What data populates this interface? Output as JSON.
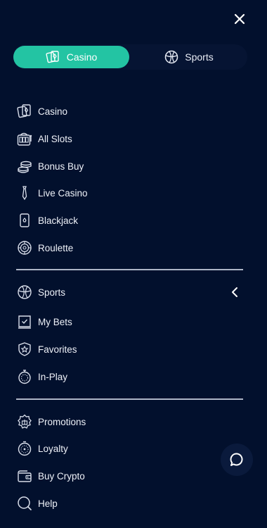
{
  "header": {
    "close_icon": "close-icon"
  },
  "toggle": {
    "casino_label": "Casino",
    "sports_label": "Sports",
    "active": "Casino",
    "accent_color": "#23c4a3"
  },
  "casino_section": {
    "items": [
      {
        "label": "Casino",
        "icon": "cards-icon"
      },
      {
        "label": "All Slots",
        "icon": "slot-machine-icon"
      },
      {
        "label": "Bonus Buy",
        "icon": "coins-icon"
      },
      {
        "label": "Live Casino",
        "icon": "tie-icon"
      },
      {
        "label": "Blackjack",
        "icon": "playing-card-icon"
      },
      {
        "label": "Roulette",
        "icon": "roulette-icon"
      }
    ]
  },
  "sports_section": {
    "items": [
      {
        "label": "Sports",
        "icon": "basketball-icon"
      },
      {
        "label": "My Bets",
        "icon": "bet-slip-icon"
      },
      {
        "label": "Favorites",
        "icon": "star-badge-icon"
      },
      {
        "label": "In-Play",
        "icon": "stopwatch-icon"
      }
    ]
  },
  "misc_section": {
    "items": [
      {
        "label": "Promotions",
        "icon": "gift-icon"
      },
      {
        "label": "Loyalty",
        "icon": "loyalty-icon"
      },
      {
        "label": "Buy Crypto",
        "icon": "wallet-icon"
      },
      {
        "label": "Help",
        "icon": "search-icon"
      }
    ]
  },
  "chat": {
    "icon": "chat-icon"
  }
}
